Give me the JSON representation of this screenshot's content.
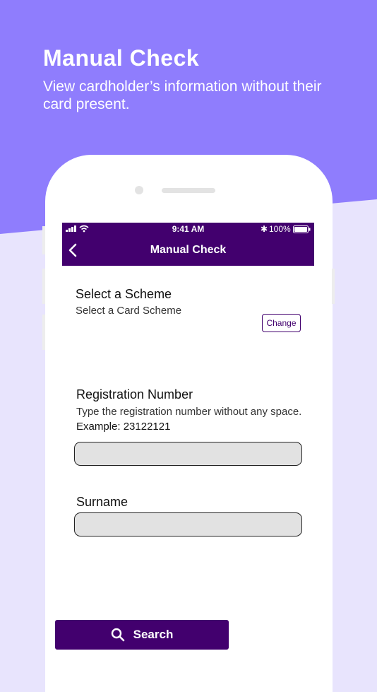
{
  "hero": {
    "title": "Manual Check",
    "subtitle": "View cardholder’s information without their card present."
  },
  "status_bar": {
    "time": "9:41 AM",
    "battery": "100%"
  },
  "nav": {
    "title": "Manual Check",
    "back_icon": "chevron-left-icon"
  },
  "scheme": {
    "heading": "Select a Scheme",
    "value": "Select a Card Scheme",
    "change_label": "Change"
  },
  "registration": {
    "label": "Registration Number",
    "helper_prefix": "Type the registration number without any space.",
    "helper_example": "Example: 23122121",
    "value": ""
  },
  "surname": {
    "label": "Surname",
    "value": ""
  },
  "search_button": {
    "label": "Search",
    "icon": "search-icon"
  },
  "colors": {
    "brand": "#42006e",
    "hero_bg": "#8f7dfd",
    "page_bg": "#e8e4fd"
  }
}
